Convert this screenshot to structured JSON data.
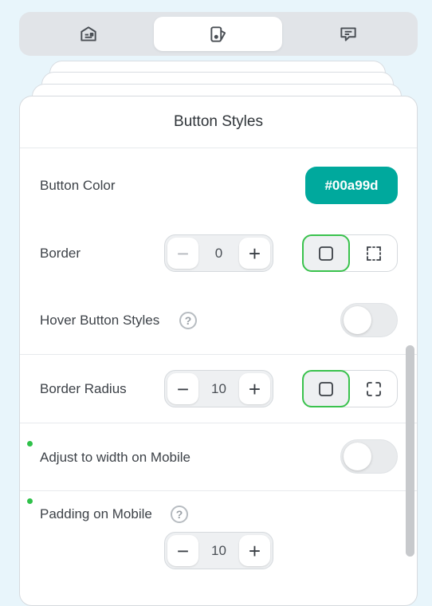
{
  "tabs": [
    {
      "name": "card-icon",
      "active": false
    },
    {
      "name": "design-icon",
      "active": true
    },
    {
      "name": "chat-icon",
      "active": false
    }
  ],
  "panel": {
    "title": "Button Styles",
    "button_color": {
      "label": "Button Color",
      "value": "#00a99d"
    },
    "border": {
      "label": "Border",
      "value": "0",
      "mode": "all-sides"
    },
    "hover": {
      "label": "Hover Button Styles",
      "help": "?",
      "enabled": false
    },
    "border_radius": {
      "label": "Border Radius",
      "value": "10",
      "mode": "all-corners"
    },
    "adjust_width": {
      "label": "Adjust to width on Mobile",
      "enabled": false,
      "changed": true
    },
    "padding_mobile": {
      "label": "Padding on Mobile",
      "help": "?",
      "value": "10",
      "changed": true
    }
  },
  "stepper_glyphs": {
    "minus": "−",
    "plus": "+"
  },
  "colors": {
    "accent": "#00a99d",
    "selected_border": "#3ac24d",
    "changed_dot": "#2fc14a"
  }
}
